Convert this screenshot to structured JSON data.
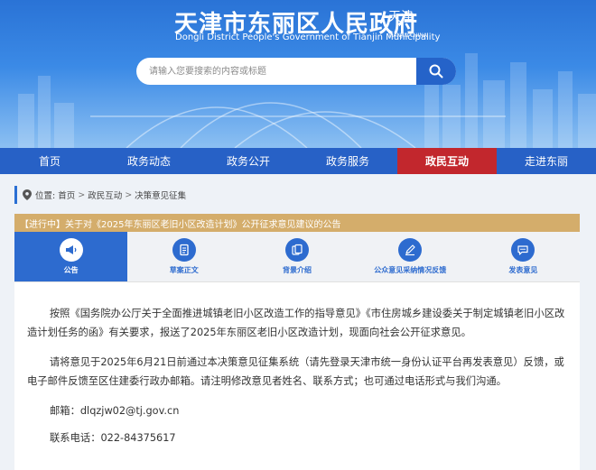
{
  "header": {
    "title": "天津市东丽区人民政府",
    "subtitle": "Dongli District People's Government of Tianjin Municipality",
    "seal_text": "天津",
    "seal_sub": "TIANJIN CHINA"
  },
  "search": {
    "placeholder": "请输入您要搜索的内容或标题"
  },
  "nav": {
    "items": [
      {
        "label": "首页"
      },
      {
        "label": "政务动态"
      },
      {
        "label": "政务公开"
      },
      {
        "label": "政务服务"
      },
      {
        "label": "政民互动"
      },
      {
        "label": "走进东丽"
      }
    ],
    "active_index": 4
  },
  "breadcrumb": {
    "prefix": "位置:",
    "items": [
      "首页",
      "政民互动",
      "决策意见征集"
    ]
  },
  "notice": {
    "status": "【进行中】",
    "title": "关于对《2025年东丽区老旧小区改造计划》公开征求意见建议的公告"
  },
  "tabs": [
    {
      "label": "公告",
      "icon": "megaphone-icon"
    },
    {
      "label": "草案正文",
      "icon": "document-icon"
    },
    {
      "label": "背景介绍",
      "icon": "files-icon"
    },
    {
      "label": "公众意见采纳情况反馈",
      "icon": "pen-icon"
    },
    {
      "label": "发表意见",
      "icon": "chat-bubble-icon"
    }
  ],
  "content": {
    "paragraph1": "按照《国务院办公厅关于全面推进城镇老旧小区改造工作的指导意见》《市住房城乡建设委关于制定城镇老旧小区改造计划任务的函》有关要求，报送了2025年东丽区老旧小区改造计划，现面向社会公开征求意见。",
    "paragraph2": "请将意见于2025年6月21日前通过本决策意见征集系统（请先登录天津市统一身份认证平台再发表意见）反馈，或电子邮件反馈至区住建委行政办邮箱。请注明修改意见者姓名、联系方式；也可通过电话形式与我们沟通。",
    "email": "邮箱：dlqzjw02@tj.gov.cn",
    "phone": "联系电话：022-84375617"
  },
  "colors": {
    "nav_bg": "#2761c6",
    "nav_active": "#c2272d",
    "notice_bar": "#d4ad6b",
    "tab_active": "#2d6bcf"
  }
}
